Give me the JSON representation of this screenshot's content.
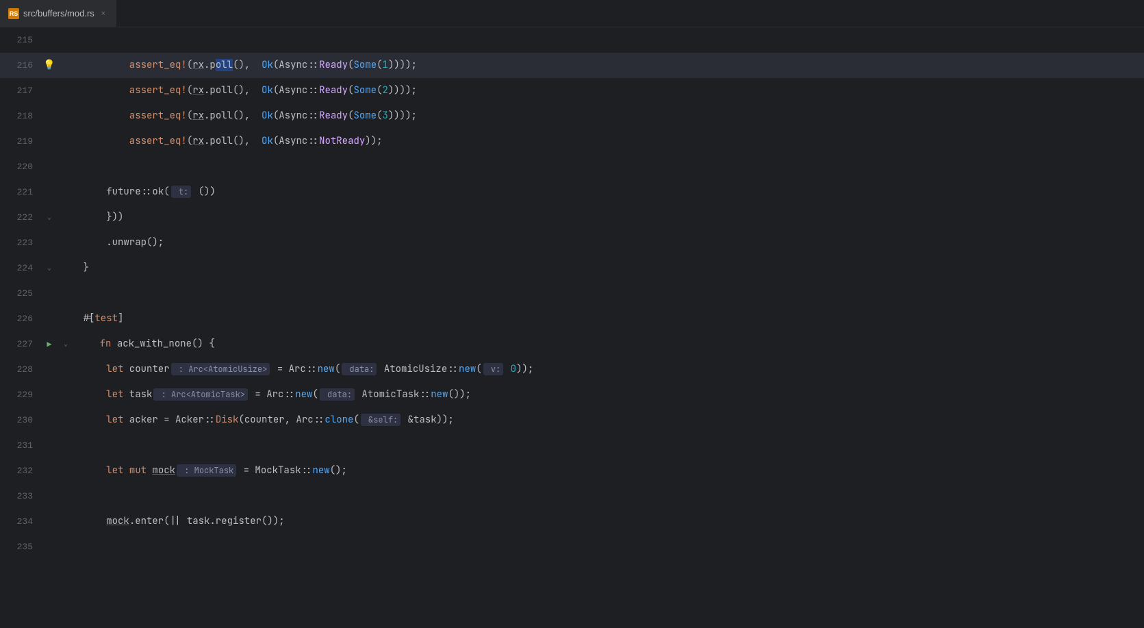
{
  "tab": {
    "icon": "RS",
    "label": "src/buffers/mod.rs",
    "close": "×"
  },
  "colors": {
    "background": "#1e1f22",
    "line_highlight": "#2a2d36",
    "gutter": "#606366"
  },
  "lines": [
    {
      "num": "215",
      "gutter": "",
      "content": []
    },
    {
      "num": "216",
      "gutter": "bulb",
      "content": [
        {
          "text": "            assert_eq!",
          "class": "macro"
        },
        {
          "text": "(",
          "class": "white"
        },
        {
          "text": "rx",
          "class": "white underline"
        },
        {
          "text": ".p",
          "class": "white"
        },
        {
          "text": "o",
          "class": "white selection"
        },
        {
          "text": "ll",
          "class": "white selection"
        },
        {
          "text": "()",
          "class": "white"
        },
        {
          "text": ",  ",
          "class": "white"
        },
        {
          "text": "Ok",
          "class": "ok-color"
        },
        {
          "text": "(",
          "class": "white"
        },
        {
          "text": "Async",
          "class": "white"
        },
        {
          "text": "::",
          "class": "white"
        },
        {
          "text": "Ready",
          "class": "ready-color"
        },
        {
          "text": "(",
          "class": "white"
        },
        {
          "text": "Some",
          "class": "some-color"
        },
        {
          "text": "(",
          "class": "white"
        },
        {
          "text": "1",
          "class": "number"
        },
        {
          "text": "))))",
          "class": "white"
        },
        {
          "text": ";",
          "class": "white"
        }
      ],
      "highlight": true
    },
    {
      "num": "217",
      "gutter": "",
      "content": [
        {
          "text": "            assert_eq!",
          "class": "macro"
        },
        {
          "text": "(",
          "class": "white"
        },
        {
          "text": "rx",
          "class": "white underline"
        },
        {
          "text": ".poll()",
          "class": "white"
        },
        {
          "text": ",  ",
          "class": "white"
        },
        {
          "text": "Ok",
          "class": "ok-color"
        },
        {
          "text": "(",
          "class": "white"
        },
        {
          "text": "Async",
          "class": "white"
        },
        {
          "text": "::",
          "class": "white"
        },
        {
          "text": "Ready",
          "class": "ready-color"
        },
        {
          "text": "(",
          "class": "white"
        },
        {
          "text": "Some",
          "class": "some-color"
        },
        {
          "text": "(",
          "class": "white"
        },
        {
          "text": "2",
          "class": "number"
        },
        {
          "text": "))))",
          "class": "white"
        },
        {
          "text": ";",
          "class": "white"
        }
      ]
    },
    {
      "num": "218",
      "gutter": "",
      "content": [
        {
          "text": "            assert_eq!",
          "class": "macro"
        },
        {
          "text": "(",
          "class": "white"
        },
        {
          "text": "rx",
          "class": "white underline"
        },
        {
          "text": ".poll()",
          "class": "white"
        },
        {
          "text": ",  ",
          "class": "white"
        },
        {
          "text": "Ok",
          "class": "ok-color"
        },
        {
          "text": "(",
          "class": "white"
        },
        {
          "text": "Async",
          "class": "white"
        },
        {
          "text": "::",
          "class": "white"
        },
        {
          "text": "Ready",
          "class": "ready-color"
        },
        {
          "text": "(",
          "class": "white"
        },
        {
          "text": "Some",
          "class": "some-color"
        },
        {
          "text": "(",
          "class": "white"
        },
        {
          "text": "3",
          "class": "number"
        },
        {
          "text": "))))",
          "class": "white"
        },
        {
          "text": ";",
          "class": "white"
        }
      ]
    },
    {
      "num": "219",
      "gutter": "",
      "content": [
        {
          "text": "            assert_eq!",
          "class": "macro"
        },
        {
          "text": "(",
          "class": "white"
        },
        {
          "text": "rx",
          "class": "white underline"
        },
        {
          "text": ".poll()",
          "class": "white"
        },
        {
          "text": ",  ",
          "class": "white"
        },
        {
          "text": "Ok",
          "class": "ok-color"
        },
        {
          "text": "(",
          "class": "white"
        },
        {
          "text": "Async",
          "class": "white"
        },
        {
          "text": "::",
          "class": "white"
        },
        {
          "text": "NotReady",
          "class": "ready-color"
        },
        {
          "text": "))",
          "class": "white"
        },
        {
          "text": ";",
          "class": "white"
        }
      ]
    },
    {
      "num": "220",
      "gutter": "",
      "content": []
    },
    {
      "num": "221",
      "gutter": "",
      "content": [
        {
          "text": "        future::ok(",
          "class": "white"
        },
        {
          "text": " t:",
          "class": "param-hint-text"
        },
        {
          "text": " ())",
          "class": "white"
        }
      ]
    },
    {
      "num": "222",
      "gutter": "fold",
      "content": [
        {
          "text": "        }))",
          "class": "white"
        }
      ]
    },
    {
      "num": "223",
      "gutter": "",
      "content": [
        {
          "text": "        .unwrap();",
          "class": "white"
        }
      ]
    },
    {
      "num": "224",
      "gutter": "fold",
      "content": [
        {
          "text": "    }",
          "class": "white"
        }
      ]
    },
    {
      "num": "225",
      "gutter": "",
      "content": []
    },
    {
      "num": "226",
      "gutter": "",
      "content": [
        {
          "text": "    #[",
          "class": "white"
        },
        {
          "text": "test",
          "class": "orange"
        },
        {
          "text": "]",
          "class": "white"
        }
      ]
    },
    {
      "num": "227",
      "gutter": "run",
      "content": [
        {
          "text": "    ",
          "class": "white"
        },
        {
          "text": "fn",
          "class": "kw"
        },
        {
          "text": " ack_with_none",
          "class": "white"
        },
        {
          "text": "() {",
          "class": "white"
        }
      ]
    },
    {
      "num": "228",
      "gutter": "",
      "content": [
        {
          "text": "        ",
          "class": "white"
        },
        {
          "text": "let",
          "class": "kw"
        },
        {
          "text": " counter",
          "class": "white"
        },
        {
          "text": " : Arc<AtomicUsize>",
          "class": "param-hint-text"
        },
        {
          "text": " = Arc::",
          "class": "white"
        },
        {
          "text": "new",
          "class": "func"
        },
        {
          "text": "(",
          "class": "white"
        },
        {
          "text": " data:",
          "class": "param-hint-text"
        },
        {
          "text": " AtomicUsize::",
          "class": "white"
        },
        {
          "text": "new",
          "class": "func"
        },
        {
          "text": "(",
          "class": "white"
        },
        {
          "text": " v:",
          "class": "param-hint-text"
        },
        {
          "text": " ",
          "class": "white"
        },
        {
          "text": "0",
          "class": "number"
        },
        {
          "text": "));",
          "class": "white"
        }
      ]
    },
    {
      "num": "229",
      "gutter": "",
      "content": [
        {
          "text": "        ",
          "class": "white"
        },
        {
          "text": "let",
          "class": "kw"
        },
        {
          "text": " task",
          "class": "white"
        },
        {
          "text": " : Arc<AtomicTask>",
          "class": "param-hint-text"
        },
        {
          "text": " = Arc::",
          "class": "white"
        },
        {
          "text": "new",
          "class": "func"
        },
        {
          "text": "(",
          "class": "white"
        },
        {
          "text": " data:",
          "class": "param-hint-text"
        },
        {
          "text": " AtomicTask::",
          "class": "white"
        },
        {
          "text": "new",
          "class": "func"
        },
        {
          "text": "());",
          "class": "white"
        }
      ]
    },
    {
      "num": "230",
      "gutter": "",
      "content": [
        {
          "text": "        ",
          "class": "white"
        },
        {
          "text": "let",
          "class": "kw"
        },
        {
          "text": " acker = Acker::",
          "class": "white"
        },
        {
          "text": "Disk",
          "class": "orange"
        },
        {
          "text": "(counter, Arc::",
          "class": "white"
        },
        {
          "text": "clone",
          "class": "func"
        },
        {
          "text": "(",
          "class": "white"
        },
        {
          "text": " &self:",
          "class": "param-hint-text"
        },
        {
          "text": " &task));",
          "class": "white"
        }
      ]
    },
    {
      "num": "231",
      "gutter": "",
      "content": []
    },
    {
      "num": "232",
      "gutter": "",
      "content": [
        {
          "text": "        ",
          "class": "white"
        },
        {
          "text": "let",
          "class": "kw"
        },
        {
          "text": " ",
          "class": "white"
        },
        {
          "text": "mut",
          "class": "kw"
        },
        {
          "text": " ",
          "class": "white"
        },
        {
          "text": "mock",
          "class": "white underline"
        },
        {
          "text": " : MockTask",
          "class": "param-hint-text"
        },
        {
          "text": " = MockTask::",
          "class": "white"
        },
        {
          "text": "new",
          "class": "func"
        },
        {
          "text": "();",
          "class": "white"
        }
      ]
    },
    {
      "num": "233",
      "gutter": "",
      "content": []
    },
    {
      "num": "234",
      "gutter": "",
      "content": [
        {
          "text": "        ",
          "class": "white"
        },
        {
          "text": "mock",
          "class": "white underline"
        },
        {
          "text": ".enter(|| task.register());",
          "class": "white"
        }
      ]
    },
    {
      "num": "235",
      "gutter": "",
      "content": []
    }
  ]
}
